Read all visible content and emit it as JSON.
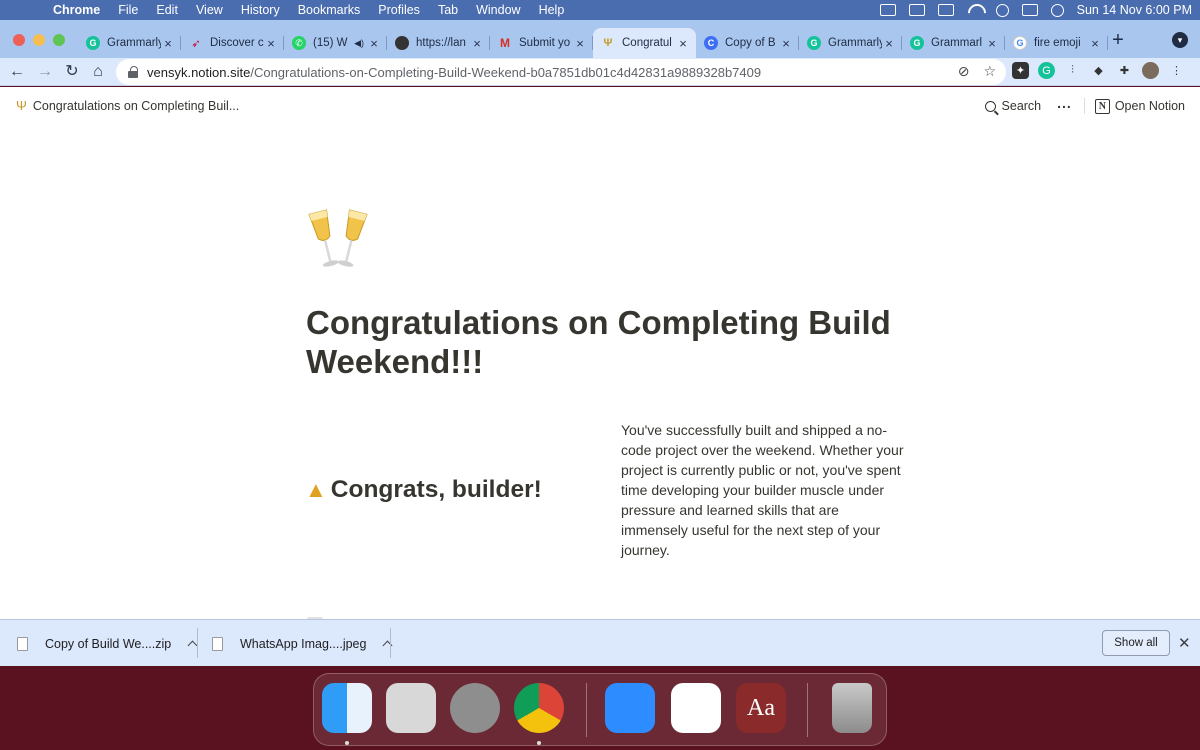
{
  "menubar": {
    "app": "Chrome",
    "items": [
      "File",
      "Edit",
      "View",
      "History",
      "Bookmarks",
      "Profiles",
      "Tab",
      "Window",
      "Help"
    ],
    "clock": "Sun 14 Nov  6:00 PM"
  },
  "tabs": [
    {
      "title": "Grammarly",
      "icon": "grammarly-icon"
    },
    {
      "title": "Discover c",
      "icon": "rocket-icon"
    },
    {
      "title": "(15) W",
      "icon": "whatsapp-icon",
      "audio": true
    },
    {
      "title": "https://lan",
      "icon": "globe-icon"
    },
    {
      "title": "Submit yo",
      "icon": "gmail-icon"
    },
    {
      "title": "Congratul",
      "icon": "cheers-icon",
      "active": true
    },
    {
      "title": "Copy of B",
      "icon": "copy-icon"
    },
    {
      "title": "Grammarly",
      "icon": "grammarly-icon"
    },
    {
      "title": "Grammarl",
      "icon": "grammarly-icon"
    },
    {
      "title": "fire emoji",
      "icon": "google-icon"
    }
  ],
  "address": {
    "host": "vensyk.notion.site",
    "path": "/Congratulations-on-Completing-Build-Weekend-b0a7851db01c4d42831a9889328b7409"
  },
  "notion": {
    "breadcrumb": "Congratulations on Completing Buil...",
    "search_label": "Search",
    "open_label": "Open Notion",
    "page_emoji": "clinking-glasses-emoji",
    "title": "Congratulations on Completing Build Weekend!!!",
    "heading": "Congrats, builder!",
    "body": "You've successfully built and shipped a no-code project over the weekend. Whether your project is currently public or not, you've spent time developing your builder muscle under pressure and learned skills that are immensely useful for the next step of your journey."
  },
  "downloads": {
    "items": [
      "Copy of Build We....zip",
      "WhatsApp Imag....jpeg"
    ],
    "show_all": "Show all"
  },
  "colors": {
    "menubar": "#4a6db0",
    "tabstrip": "#a9c6ee",
    "toolbar": "#dce8fb",
    "notion_text": "#37352f",
    "desktop": "#5a1220"
  }
}
